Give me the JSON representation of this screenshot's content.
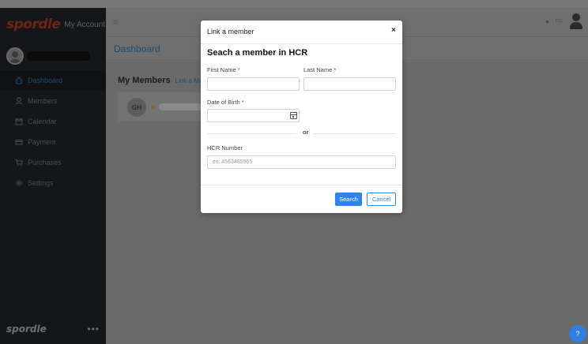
{
  "app": {
    "brand_logo": "spordle",
    "brand_sub": "My Account",
    "page_title": "Dashboard",
    "language": "FR",
    "help_label": "?",
    "footer_logo": "spordle",
    "footer_more": "•••"
  },
  "sidebar": {
    "items": [
      {
        "label": "Dashboard",
        "icon": "home-icon",
        "active": true
      },
      {
        "label": "Members",
        "icon": "person-icon"
      },
      {
        "label": "Calendar",
        "icon": "calendar-icon"
      },
      {
        "label": "Payment",
        "icon": "credit-card-icon"
      },
      {
        "label": "Purchases",
        "icon": "cart-icon"
      },
      {
        "label": "Settings",
        "icon": "gear-icon"
      }
    ]
  },
  "members": {
    "title": "My Members",
    "link_label": "Link a Me",
    "card_initials": "GH"
  },
  "modal": {
    "title": "Link a member",
    "close_label": "×",
    "section_title": "Seach a member in HCR",
    "first_name_label": "First Name",
    "last_name_label": "Last Name",
    "dob_label": "Date of Birth",
    "required_mark": "*",
    "or_label": "or",
    "hcr_label": "HCR Number",
    "hcr_placeholder": "ex: 4563485965",
    "search_label": "Search",
    "cancel_label": "Cancel"
  },
  "colors": {
    "primary": "#2f84e8",
    "required": "#d8302f",
    "sidebar_bg": "#141619",
    "overlay": "#6f6f6f"
  }
}
